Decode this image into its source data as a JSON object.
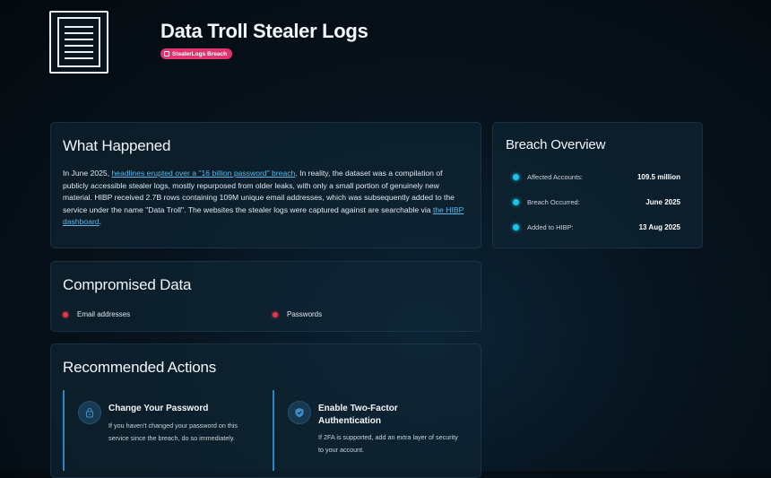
{
  "header": {
    "title": "Data Troll Stealer Logs",
    "badge": "StealerLogs Breach",
    "logo_icon": "document-lines-icon"
  },
  "what_happened": {
    "heading": "What Happened",
    "text_1": "In June 2025, ",
    "link_1": "headlines erupted over a \"16 billion password\" breach",
    "text_2": ". In reality, the dataset was a compilation of publicly accessible stealer logs, mostly repurposed from older leaks, with only a small portion of genuinely new material. HIBP received 2.7B rows containing 109M unique email addresses, which was subsequently added to the service under the name \"Data Troll\". The websites the stealer logs were captured against are searchable via ",
    "link_2": "the HIBP dashboard",
    "text_3": "."
  },
  "overview": {
    "heading": "Breach Overview",
    "rows": [
      {
        "label": "Affected Accounts:",
        "value": "109.5 million"
      },
      {
        "label": "Breach Occurred:",
        "value": "June 2025"
      },
      {
        "label": "Added to HIBP:",
        "value": "13 Aug 2025"
      }
    ],
    "dot_color": "#20c3e6"
  },
  "compromised": {
    "heading": "Compromised Data",
    "items": [
      "Email addresses",
      "Passwords"
    ],
    "dot_color": "#e3384a"
  },
  "actions": {
    "heading": "Recommended Actions",
    "items": [
      {
        "icon": "lock-icon",
        "title": "Change Your Password",
        "text": "If you haven't changed your password on this service since the breach, do so immediately."
      },
      {
        "icon": "shield-icon",
        "title": "Enable Two-Factor Authentication",
        "text": "If 2FA is supported, add an extra layer of security to your account."
      }
    ]
  },
  "colors": {
    "badge": "#e0336f",
    "accent_blue": "#2a87c8",
    "link": "#5fb7e6"
  }
}
